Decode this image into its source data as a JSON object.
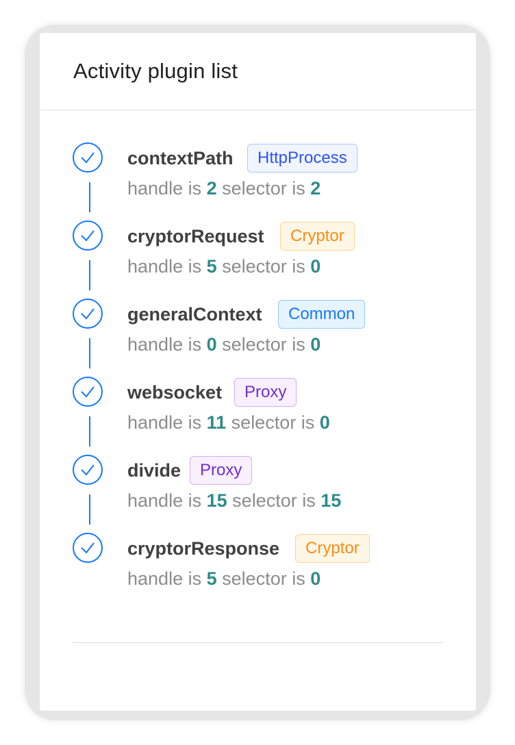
{
  "title": "Activity plugin list",
  "desc": {
    "handle_prefix": "handle is",
    "selector_prefix": "selector is"
  },
  "colors": {
    "accent": "#1677ff",
    "number": "#2e8b8b"
  },
  "items": [
    {
      "name": "contextPath",
      "tag": "HttpProcess",
      "handle": "2",
      "selector": "2"
    },
    {
      "name": "cryptorRequest",
      "tag": "Cryptor",
      "handle": "5",
      "selector": "0"
    },
    {
      "name": "generalContext",
      "tag": "Common",
      "handle": "0",
      "selector": "0"
    },
    {
      "name": "websocket",
      "tag": "Proxy",
      "handle": "11",
      "selector": "0"
    },
    {
      "name": "divide",
      "tag": "Proxy",
      "handle": "15",
      "selector": "15"
    },
    {
      "name": "cryptorResponse",
      "tag": "Cryptor",
      "handle": "5",
      "selector": "0"
    }
  ]
}
